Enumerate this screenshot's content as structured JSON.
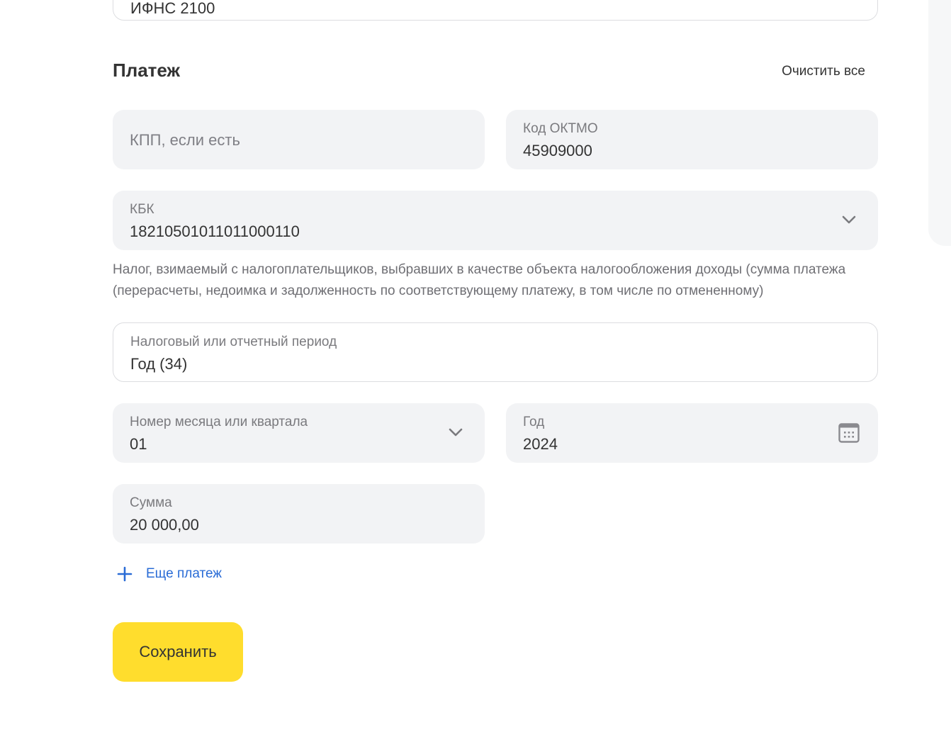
{
  "inspection": {
    "value": "ИФНС 2100"
  },
  "payment": {
    "title": "Платеж",
    "clear_all": "Очистить все",
    "kpp": {
      "placeholder": "КПП, если есть"
    },
    "oktmo": {
      "label": "Код ОКТМО",
      "value": "45909000"
    },
    "kbk": {
      "label": "КБК",
      "value": "18210501011011000110",
      "description": "Налог, взимаемый с налогоплательщиков, выбравших в качестве объекта налогообложения доходы (сумма платежа (перерасчеты, недоимка и задолженность по соответствующему платежу, в том числе по отмененному)"
    },
    "period": {
      "label": "Налоговый или отчетный период",
      "value": "Год (34)"
    },
    "month_quarter": {
      "label": "Номер месяца или квартала",
      "value": "01"
    },
    "year": {
      "label": "Год",
      "value": "2024"
    },
    "amount": {
      "label": "Сумма",
      "value": "20 000,00"
    },
    "add_payment": "Еще платеж",
    "save": "Сохранить"
  },
  "icons": {
    "chevron": "chevron-down-icon",
    "calendar": "calendar-icon",
    "plus": "plus-icon"
  },
  "colors": {
    "accent_yellow": "#ffdd2d",
    "link_blue": "#2a6cd6",
    "field_bg": "#f2f3f5"
  }
}
